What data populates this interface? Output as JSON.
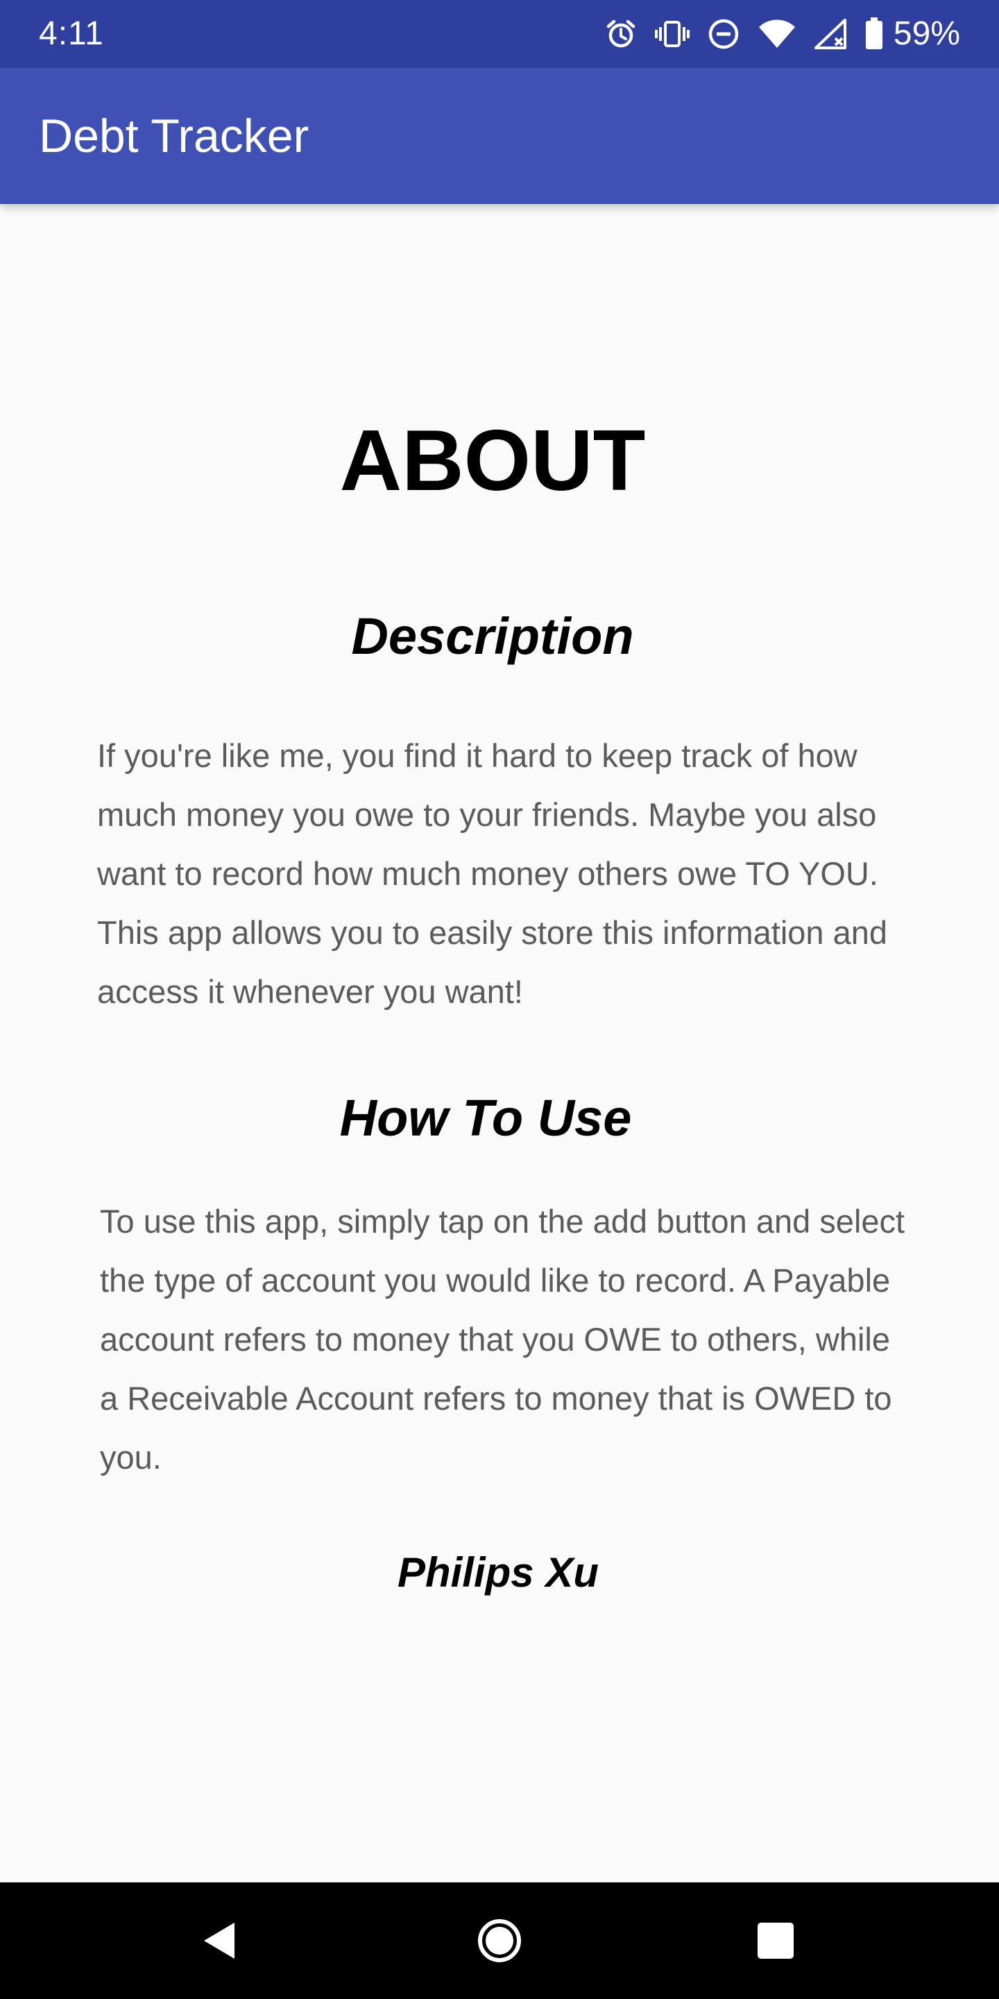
{
  "status_bar": {
    "time": "4:11",
    "battery_percent": "59%",
    "icons": [
      "alarm-icon",
      "vibrate-icon",
      "do-not-disturb-icon",
      "wifi-icon",
      "cell-signal-icon",
      "battery-icon"
    ],
    "background_color": "#2f3f9e"
  },
  "app_bar": {
    "title": "Debt Tracker",
    "background_color": "#3f51b5"
  },
  "about": {
    "heading": "ABOUT",
    "description_heading": "Description",
    "description_text": "If you're like me, you find it hard to keep track of how much money you owe to your friends. Maybe you also want to record how much money others owe TO YOU. This app allows you to easily store this information and access it whenever you want!",
    "how_to_heading": "How To Use",
    "how_to_text": "To use this app, simply tap on the add button and select the type of account you would like to record. A Payable account refers to money that you OWE to others, while a Receivable Account refers to money that is OWED to you.",
    "author": "Philips Xu"
  },
  "nav_bar": {
    "buttons": [
      "back-icon",
      "home-icon",
      "recents-icon"
    ]
  }
}
